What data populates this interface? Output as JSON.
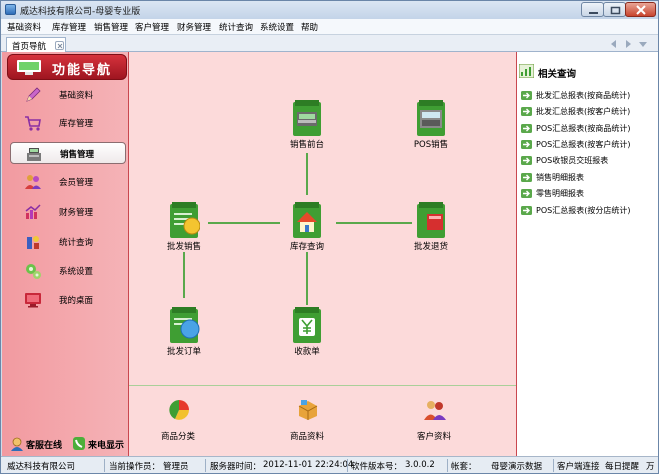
{
  "window": {
    "title": "威达科技有限公司-母婴专业版"
  },
  "menu": [
    "基础资料",
    "库存管理",
    "销售管理",
    "客户管理",
    "财务管理",
    "统计查询",
    "系统设置",
    "帮助"
  ],
  "tabs": {
    "home_label": "首页导航"
  },
  "nav": {
    "header": "功能导航",
    "items": [
      {
        "label": "基础资料",
        "icon": "pencil-icon",
        "selected": false
      },
      {
        "label": "库存管理",
        "icon": "cart-icon",
        "selected": false
      },
      {
        "label": "销售管理",
        "icon": "cash-register-icon",
        "selected": true
      },
      {
        "label": "会员管理",
        "icon": "members-icon",
        "selected": false
      },
      {
        "label": "财务管理",
        "icon": "finance-chart-icon",
        "selected": false
      },
      {
        "label": "统计查询",
        "icon": "statistics-icon",
        "selected": false
      },
      {
        "label": "系统设置",
        "icon": "settings-icon",
        "selected": false
      },
      {
        "label": "我的桌面",
        "icon": "desktop-icon",
        "selected": false
      }
    ],
    "footer": {
      "service_label": "客服在线",
      "caller_label": "来电显示"
    }
  },
  "workflow": {
    "sales_counter": "销售前台",
    "pos_sales": "POS销售",
    "wholesale_sales": "批发销售",
    "inventory_query": "库存查询",
    "wholesale_return": "批发退货",
    "wholesale_order": "批发订单",
    "receipt": "收款单"
  },
  "bottom": {
    "category": "商品分类",
    "product": "商品资料",
    "customer": "客户资料"
  },
  "related": {
    "title": "相关查询",
    "links": [
      "批发汇总报表(按商品统计)",
      "批发汇总报表(按客户统计)",
      "POS汇总报表(按商品统计)",
      "POS汇总报表(按客户统计)",
      "POS收银员交班报表",
      "销售明细报表",
      "零售明细报表",
      "POS汇总报表(按分店统计)"
    ]
  },
  "status": {
    "company": "威达科技有限公司",
    "operator_label": "当前操作员：",
    "operator": "管理员",
    "server_time_label": "服务器时间：",
    "server_time": "2012-11-01 22:24:04",
    "version_label": "软件版本号：",
    "version": "3.0.0.2",
    "account_label": "帐套：",
    "account": "母婴演示数据",
    "client_connect": "客户端连接",
    "daily_reminder": "每日提醒",
    "last": "万"
  },
  "colors": {
    "accent": "#c42a33",
    "panel_bg": "#fcdada",
    "connector": "#5aa84b"
  }
}
